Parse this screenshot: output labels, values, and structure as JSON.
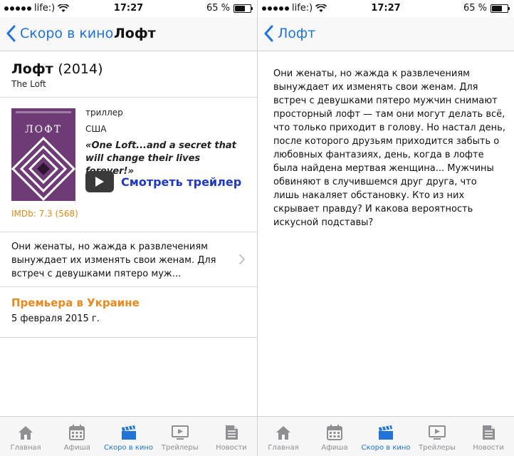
{
  "status_bar": {
    "carrier": "life:)",
    "time": "17:27",
    "battery_percent": "65 %",
    "battery_level": 0.65
  },
  "left_screen": {
    "nav": {
      "back_label": "Скоро в кино",
      "title": "Лофт"
    },
    "movie": {
      "title": "Лофт",
      "year": "(2014)",
      "original_title": "The Loft",
      "poster_title": "ЛОФТ",
      "genre": "триллер",
      "country": "США",
      "tagline": "«One Loft...and a secret that will change their lives forever!»",
      "trailer_label": "Смотреть трейлер",
      "imdb": "IMDb: 7.3 (568)"
    },
    "description_preview": "Они женаты, но жажда к развлечениям вынуждает их изменять свои женам. Для встреч с девушками пятеро муж…",
    "premiere": {
      "title": "Премьера в Украине",
      "date": "5 февраля 2015 г."
    }
  },
  "right_screen": {
    "nav": {
      "back_label": "Лофт"
    },
    "description": "Они женаты, но жажда к развлечениям вынуждает их изменять свои женам. Для встреч с девушками пятеро мужчин снимают просторный лофт — там они могут делать всё, что только приходит в голову. Но настал день, после которого друзьям приходится забыть о любовных фантазиях, день, когда в лофте была найдена мертвая женщина... Мужчины обвиняют в случившемся друг друга, что лишь накаляет обстановку. Кто из них скрывает правду? И какова вероятность искусной подставы?"
  },
  "tabs": [
    {
      "label": "Главная",
      "icon": "home-icon"
    },
    {
      "label": "Афиша",
      "icon": "calendar-icon"
    },
    {
      "label": "Скоро в кино",
      "icon": "clapperboard-icon",
      "active": true
    },
    {
      "label": "Трейлеры",
      "icon": "video-screen-icon"
    },
    {
      "label": "Новости",
      "icon": "news-icon"
    }
  ],
  "colors": {
    "accent": "#1f73d9",
    "trailer_link": "#1d39c4",
    "orange": "#e8891c",
    "tab_inactive": "#8e8e93"
  }
}
